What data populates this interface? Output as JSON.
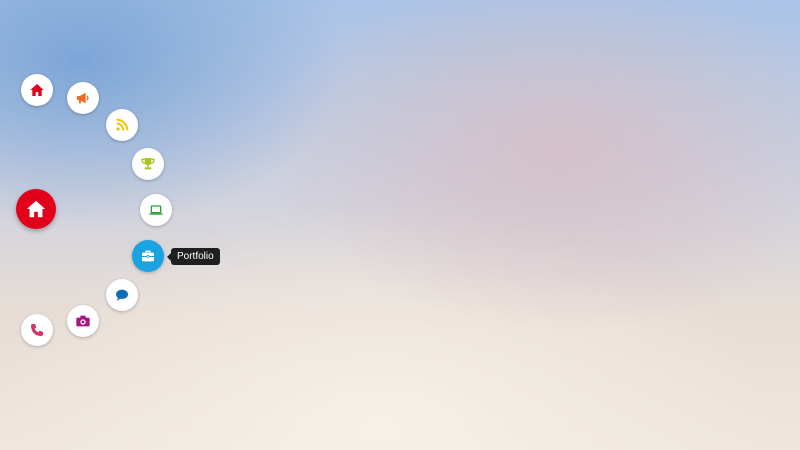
{
  "menu": {
    "trigger": {
      "icon": "home-icon",
      "color": "#e3001b"
    },
    "items": [
      {
        "icon": "home-icon",
        "color": "#e3001b"
      },
      {
        "icon": "megaphone-icon",
        "color": "#f26b21"
      },
      {
        "icon": "rss-icon",
        "color": "#f5c400"
      },
      {
        "icon": "trophy-icon",
        "color": "#a8c61e"
      },
      {
        "icon": "laptop-icon",
        "color": "#2e9e3a"
      },
      {
        "icon": "briefcase-icon",
        "color": "#1aa3e0",
        "active": true,
        "tooltip": "Portfolio"
      },
      {
        "icon": "chat-bubble-icon",
        "color": "#0e6db3"
      },
      {
        "icon": "camera-icon",
        "color": "#a01a82"
      },
      {
        "icon": "phone-icon",
        "color": "#d62f6a"
      }
    ]
  }
}
